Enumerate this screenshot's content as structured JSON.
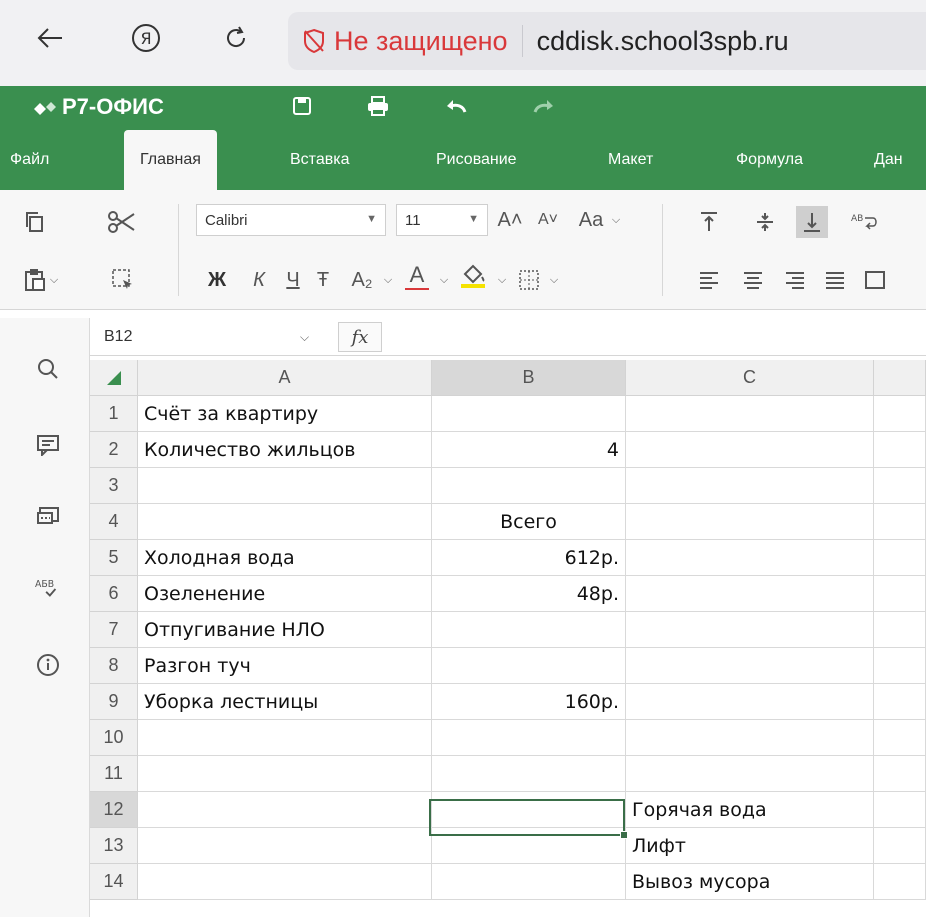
{
  "browser": {
    "security_label": "Не защищено",
    "host": "cddisk.school3spb.ru"
  },
  "app": {
    "title": "Р7-ОФИС"
  },
  "tabs": [
    "Файл",
    "Главная",
    "Вставка",
    "Рисование",
    "Макет",
    "Формула",
    "Дан"
  ],
  "active_tab": "Главная",
  "toolbar": {
    "font_name": "Calibri",
    "font_size": "11",
    "bold": "Ж",
    "italic": "К",
    "underline": "Ч",
    "strike": "Ŧ",
    "subscript": "A₂",
    "font_color": "A",
    "grow": "A˄",
    "shrink": "A˅",
    "case": "Aa"
  },
  "formula_bar": {
    "cell_ref": "B12",
    "fx": "fx",
    "formula": ""
  },
  "columns": [
    "A",
    "B",
    "C"
  ],
  "rows": [
    {
      "n": "1",
      "a": "Счёт за квартиру",
      "b": "",
      "c": ""
    },
    {
      "n": "2",
      "a": "Количество жильцов",
      "b": "4",
      "c": ""
    },
    {
      "n": "3",
      "a": "",
      "b": "",
      "c": ""
    },
    {
      "n": "4",
      "a": "",
      "b": "Всего",
      "c": ""
    },
    {
      "n": "5",
      "a": "Холодная вода",
      "b": "612р.",
      "c": ""
    },
    {
      "n": "6",
      "a": "Озеленение",
      "b": "48р.",
      "c": ""
    },
    {
      "n": "7",
      "a": "Отпугивание НЛО",
      "b": "",
      "c": ""
    },
    {
      "n": "8",
      "a": "Разгон туч",
      "b": "",
      "c": ""
    },
    {
      "n": "9",
      "a": "Уборка лестницы",
      "b": "160р.",
      "c": ""
    },
    {
      "n": "10",
      "a": "",
      "b": "",
      "c": ""
    },
    {
      "n": "11",
      "a": "",
      "b": "",
      "c": ""
    },
    {
      "n": "12",
      "a": "",
      "b": "",
      "c": "Горячая вода"
    },
    {
      "n": "13",
      "a": "",
      "b": "",
      "c": "Лифт"
    },
    {
      "n": "14",
      "a": "",
      "b": "",
      "c": "Вывоз мусора"
    }
  ],
  "colors": {
    "brand_green": "#3a8f4f",
    "selection": "#3a6e48",
    "warning": "#d9383a"
  }
}
